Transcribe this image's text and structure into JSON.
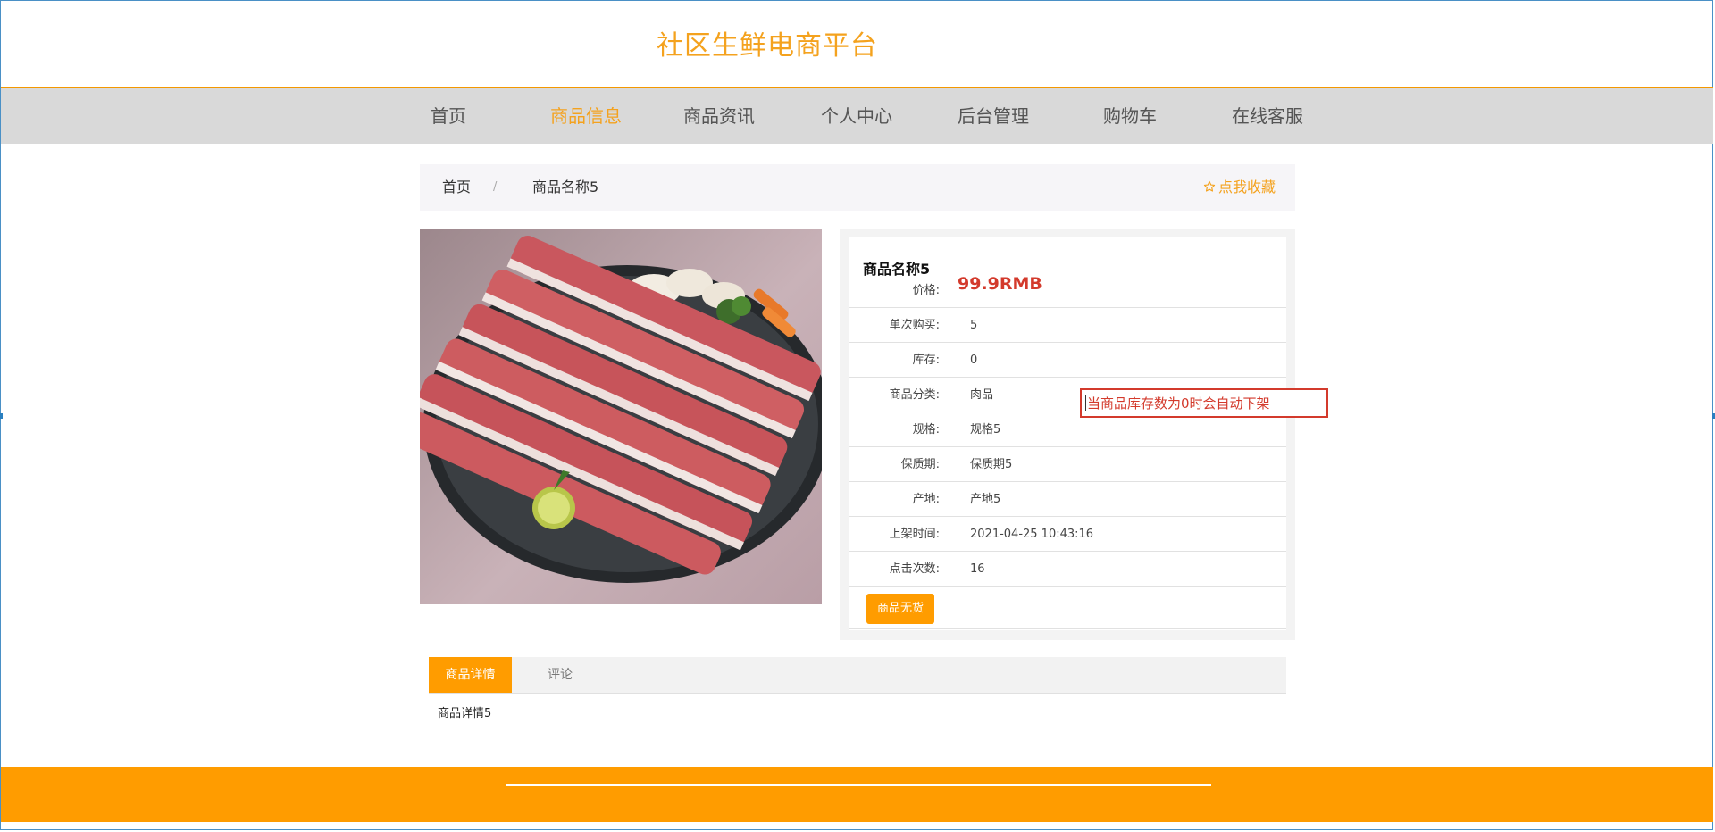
{
  "header": {
    "title": "社区生鲜电商平台"
  },
  "nav": {
    "items": [
      {
        "label": "首页"
      },
      {
        "label": "商品信息"
      },
      {
        "label": "商品资讯"
      },
      {
        "label": "个人中心"
      },
      {
        "label": "后台管理"
      },
      {
        "label": "购物车"
      },
      {
        "label": "在线客服"
      }
    ],
    "active": "商品信息"
  },
  "breadcrumb": {
    "home": "首页",
    "separator": "/",
    "current": "商品名称5",
    "favorite_icon": "star-outline-icon",
    "favorite_label": "点我收藏"
  },
  "product": {
    "image": "grilled-pork-slices-on-plate",
    "name": "商品名称5",
    "price_label": "价格:",
    "price": "99.9RMB",
    "rows": [
      {
        "label": "单次购买:",
        "value": "5"
      },
      {
        "label": "库存:",
        "value": "0"
      },
      {
        "label": "商品分类:",
        "value": "肉品"
      },
      {
        "label": "规格:",
        "value": "规格5"
      },
      {
        "label": "保质期:",
        "value": "保质期5"
      },
      {
        "label": "产地:",
        "value": "产地5"
      },
      {
        "label": "上架时间:",
        "value": "2021-04-25 10:43:16"
      },
      {
        "label": "点击次数:",
        "value": "16"
      }
    ],
    "stock_button": "商品无货",
    "notice": "当商品库存数为0时会自动下架"
  },
  "tabs": {
    "items": [
      {
        "label": "商品详情"
      },
      {
        "label": "评论"
      }
    ],
    "content": "商品详情5"
  },
  "colors": {
    "accent": "#ff9c00",
    "price": "#d33a2c",
    "title": "#f4a21e",
    "nav_bg": "#d9d9d9"
  }
}
